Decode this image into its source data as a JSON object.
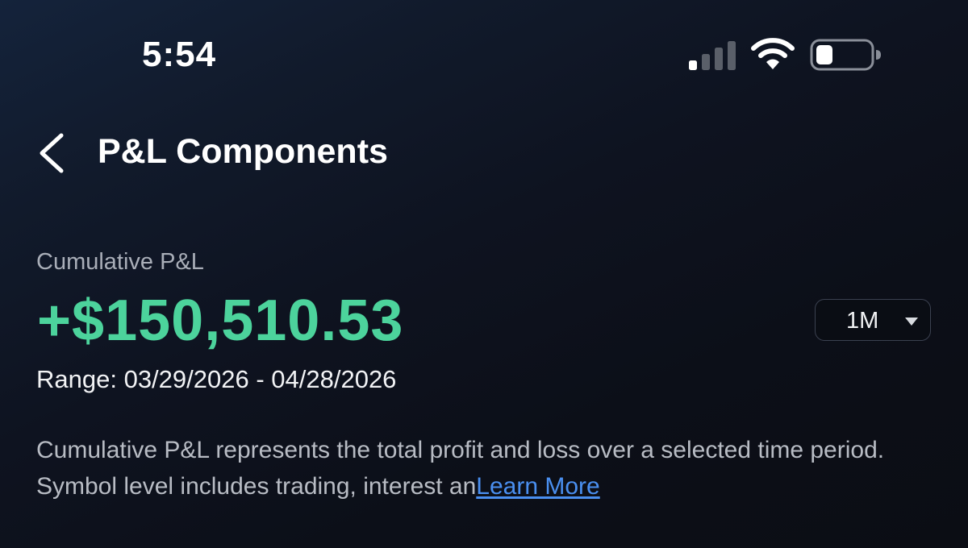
{
  "status_bar": {
    "time": "5:54",
    "icons": [
      "cellular-signal-icon",
      "wifi-icon",
      "battery-icon"
    ]
  },
  "header": {
    "back_icon": "chevron-left-icon",
    "title": "P&L Components"
  },
  "summary": {
    "label": "Cumulative P&L",
    "value": "+$150,510.53",
    "range": "Range: 03/29/2026 - 04/28/2026"
  },
  "period_selector": {
    "selected": "1M",
    "icon": "caret-down-icon"
  },
  "description": {
    "text": "Cumulative P&L represents the total profit and loss over a selected time period. Symbol level includes trading, interest an",
    "link_label": "Learn More"
  },
  "colors": {
    "positive": "#4cd39c",
    "link": "#4a8ff0",
    "muted_text": "#a9aeb8",
    "background": "#0e1320"
  }
}
